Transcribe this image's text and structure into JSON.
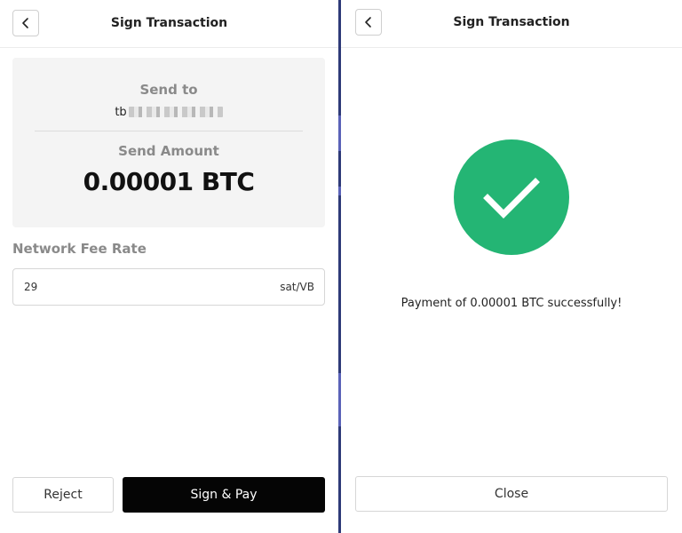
{
  "left_panel": {
    "header": {
      "title": "Sign Transaction",
      "back_icon": "chevron-left-icon"
    },
    "summary": {
      "send_to_label": "Send to",
      "address_prefix": "tb",
      "send_amount_label": "Send Amount",
      "amount": "0.00001 BTC"
    },
    "fee": {
      "label": "Network Fee Rate",
      "value": "29",
      "unit": "sat/VB"
    },
    "actions": {
      "reject_label": "Reject",
      "sign_pay_label": "Sign & Pay"
    }
  },
  "right_panel": {
    "header": {
      "title": "Sign Transaction",
      "back_icon": "chevron-left-icon"
    },
    "success": {
      "icon": "checkmark-icon",
      "message": "Payment of 0.00001 BTC successfully!"
    },
    "actions": {
      "close_label": "Close"
    }
  },
  "colors": {
    "success_green": "#24b574",
    "primary_button": "#050505",
    "card_background": "#f4f4f4",
    "muted_label": "#8a8a8a",
    "divider_blue": "#2e3a78"
  }
}
